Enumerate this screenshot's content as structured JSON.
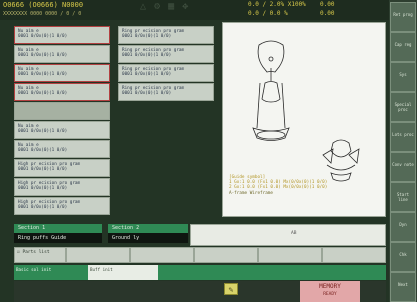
{
  "header": {
    "program_ids": "O0666 (O0666) N0000",
    "sub": "XXXXXXXX 0000 0000 / 0 / 0",
    "pos_a": "0.0 / 2.0% X100%",
    "pos_b": "0.0 / 0.0 %",
    "feed_a": "0.00",
    "feed_b": "0.00"
  },
  "left_list": {
    "items": [
      {
        "line1": "Nu aim e",
        "line2": "0001 0/0x(0)(1 0/0)"
      },
      {
        "line1": "Nu aim e",
        "line2": "0001 0/0x(0)(1 0/0)"
      },
      {
        "line1": "Nu aim e",
        "line2": "0001 0/0x(0)(1 0/0)"
      },
      {
        "line1": "Nu aim e",
        "line2": "0001 0/0x(0)(1 0/0)"
      },
      {
        "line1": "",
        "line2": ""
      },
      {
        "line1": "Nu aim e",
        "line2": "0001 0/0x(0)(1 0/0)"
      },
      {
        "line1": "Nu aim e",
        "line2": "0001 0/0x(0)(1 0/0)"
      },
      {
        "line1": "High pr ecision pro gram",
        "line2": "0001 0/0x(0)(1 0/0)"
      },
      {
        "line1": "High pr ecision pro gram",
        "line2": "0001 0/0x(0)(1 0/0)"
      },
      {
        "line1": "High pr ecision pro gram",
        "line2": "0001 0/0x(0)(1 0/0)"
      }
    ],
    "items_right": [
      {
        "line1": "Ring pr ecision pro gram",
        "line2": "0001 0/0x(0)(1 0/0)"
      },
      {
        "line1": "Ring pr ecision pro gram",
        "line2": "0001 0/0x(0)(1 0/0)"
      },
      {
        "line1": "Ring pr ecision pro gram",
        "line2": "0001 0/0x(0)(1 0/0)"
      },
      {
        "line1": "Ring pr ecision pro gram",
        "line2": "0001 0/0x(0)(1 0/0)"
      }
    ]
  },
  "preview": {
    "note_line1": "[Guide symbol]",
    "note_line2": "1  Gx:1 0.0 (Fx1 0.0) Mx(0/0x(0)(1 0/0)",
    "note_line3": "2  Gx:1 0.0 (Fx1 0.0) Mx(0/0x(0)(1 0/0)",
    "note_bottom": "A-frame  Wireframe"
  },
  "sections": {
    "tab1": "Section 1",
    "tab2": "Section 2",
    "val1": "Ring puffs  Guide",
    "val2": "Ground ly",
    "mid_label": "AB"
  },
  "function_row": {
    "fn1": "Parts list"
  },
  "status": {
    "st1": "Basic\nsol\ninit",
    "st2": "Buff\ninit"
  },
  "memory": {
    "label": "MEMORY",
    "sub": "READY"
  },
  "side_buttons": [
    "Ret\nprog",
    "Cap\nreg",
    "Sys",
    "Special\nproc",
    "Lots\nproc",
    "Conv\nnote",
    "Start\nline",
    "Dyn",
    "Chk",
    "Next"
  ],
  "colors": {
    "accent": "#2f8a55",
    "header_text": "#d7c94a",
    "memory_bg": "#e2a7a8"
  }
}
